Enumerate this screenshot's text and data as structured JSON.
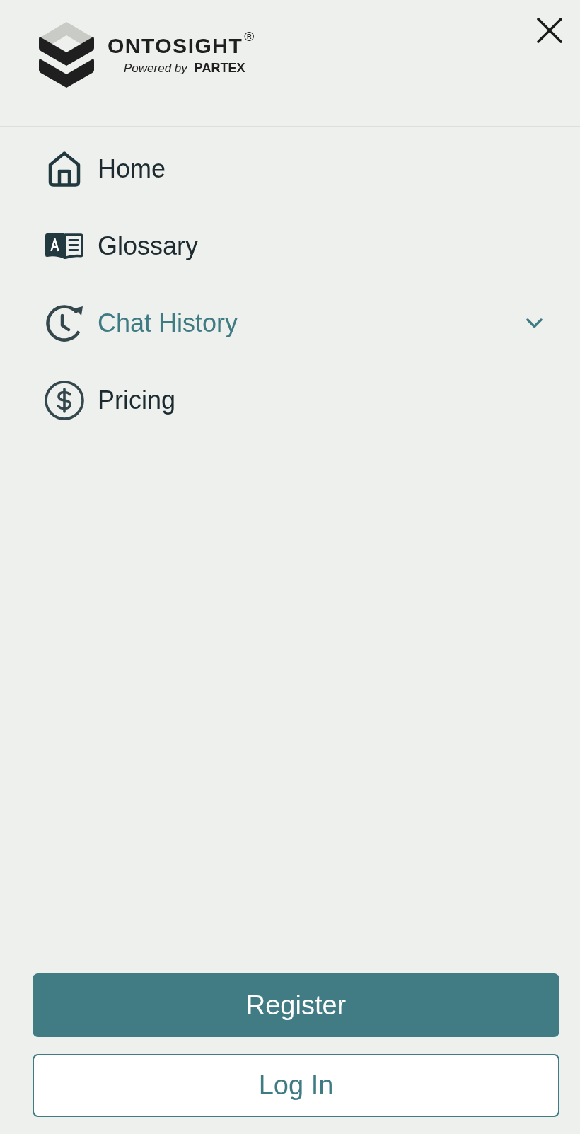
{
  "header": {
    "logo": {
      "name": "ONTOSIGHT",
      "registered": "®",
      "tagline": "Powered by",
      "company": "PARTEX"
    }
  },
  "menu": {
    "items": [
      {
        "label": "Home",
        "kind": "link",
        "selected": false
      },
      {
        "label": "Glossary",
        "kind": "link",
        "selected": false
      },
      {
        "label": "Chat History",
        "kind": "expandable",
        "selected": true,
        "expanded": false
      },
      {
        "label": "Pricing",
        "kind": "link",
        "selected": false
      }
    ]
  },
  "actions": [
    {
      "label": "Register",
      "kind": "primary"
    },
    {
      "label": "Log In",
      "kind": "secondary"
    }
  ]
}
